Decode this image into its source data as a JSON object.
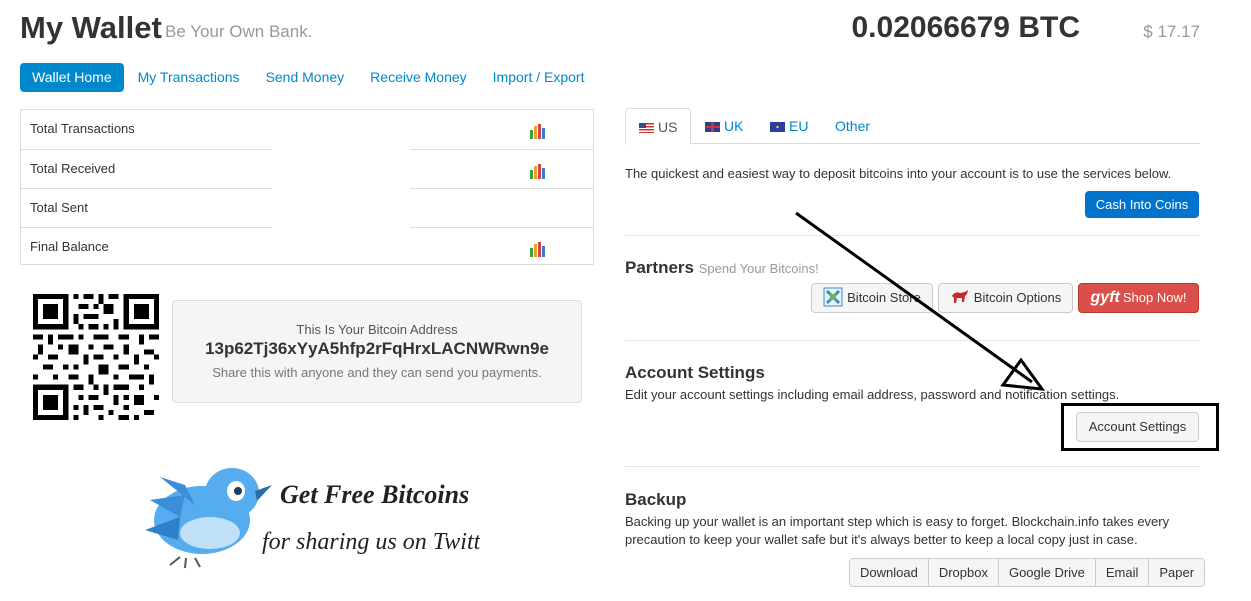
{
  "header": {
    "title": "My Wallet",
    "tagline": "Be Your Own Bank.",
    "balance_btc": "0.02066679 BTC",
    "balance_usd": "$ 17.17"
  },
  "nav": {
    "items": [
      {
        "label": "Wallet Home",
        "active": true
      },
      {
        "label": "My Transactions"
      },
      {
        "label": "Send Money"
      },
      {
        "label": "Receive Money"
      },
      {
        "label": "Import / Export"
      }
    ]
  },
  "stats": {
    "rows": [
      {
        "label": "Total Transactions",
        "chart_icon": true
      },
      {
        "label": "Total Received",
        "chart_icon": true
      },
      {
        "label": "Total Sent",
        "chart_icon": false
      },
      {
        "label": "Final Balance",
        "chart_icon": true
      }
    ]
  },
  "address": {
    "caption": "This Is Your Bitcoin Address",
    "value": "13p62Tj36xYyA5hfp2rFqHrxLACNWRwn9e",
    "help": "Share this with anyone and they can send you payments."
  },
  "promo": {
    "line1": "Get Free Bitcoins",
    "line2": "for sharing us on Twitter"
  },
  "region_tabs": {
    "us": "US",
    "uk": "UK",
    "eu": "EU",
    "other": "Other"
  },
  "deposit": {
    "text": "The quickest and easiest way to deposit bitcoins into your account is to use the services below.",
    "button": "Cash Into Coins"
  },
  "partners": {
    "title": "Partners",
    "subtitle": "Spend Your Bitcoins!",
    "store": "Bitcoin Store",
    "options": "Bitcoin Options",
    "gyft_logo": "gyft",
    "gyft": "Shop Now!"
  },
  "account": {
    "title": "Account Settings",
    "text": "Edit your account settings including email address, password and notification settings.",
    "button": "Account Settings"
  },
  "backup": {
    "title": "Backup",
    "text1": "Backing up your wallet is an important step which is easy to forget. Blockchain.info takes every",
    "text2": "precaution to keep your wallet safe but it's always better to keep a local copy just in case.",
    "buttons": [
      "Download",
      "Dropbox",
      "Google Drive",
      "Email",
      "Paper"
    ]
  },
  "colors": {
    "accent": "#0088cc",
    "primary_button": "#0074cc",
    "danger_button": "#da4f49"
  }
}
